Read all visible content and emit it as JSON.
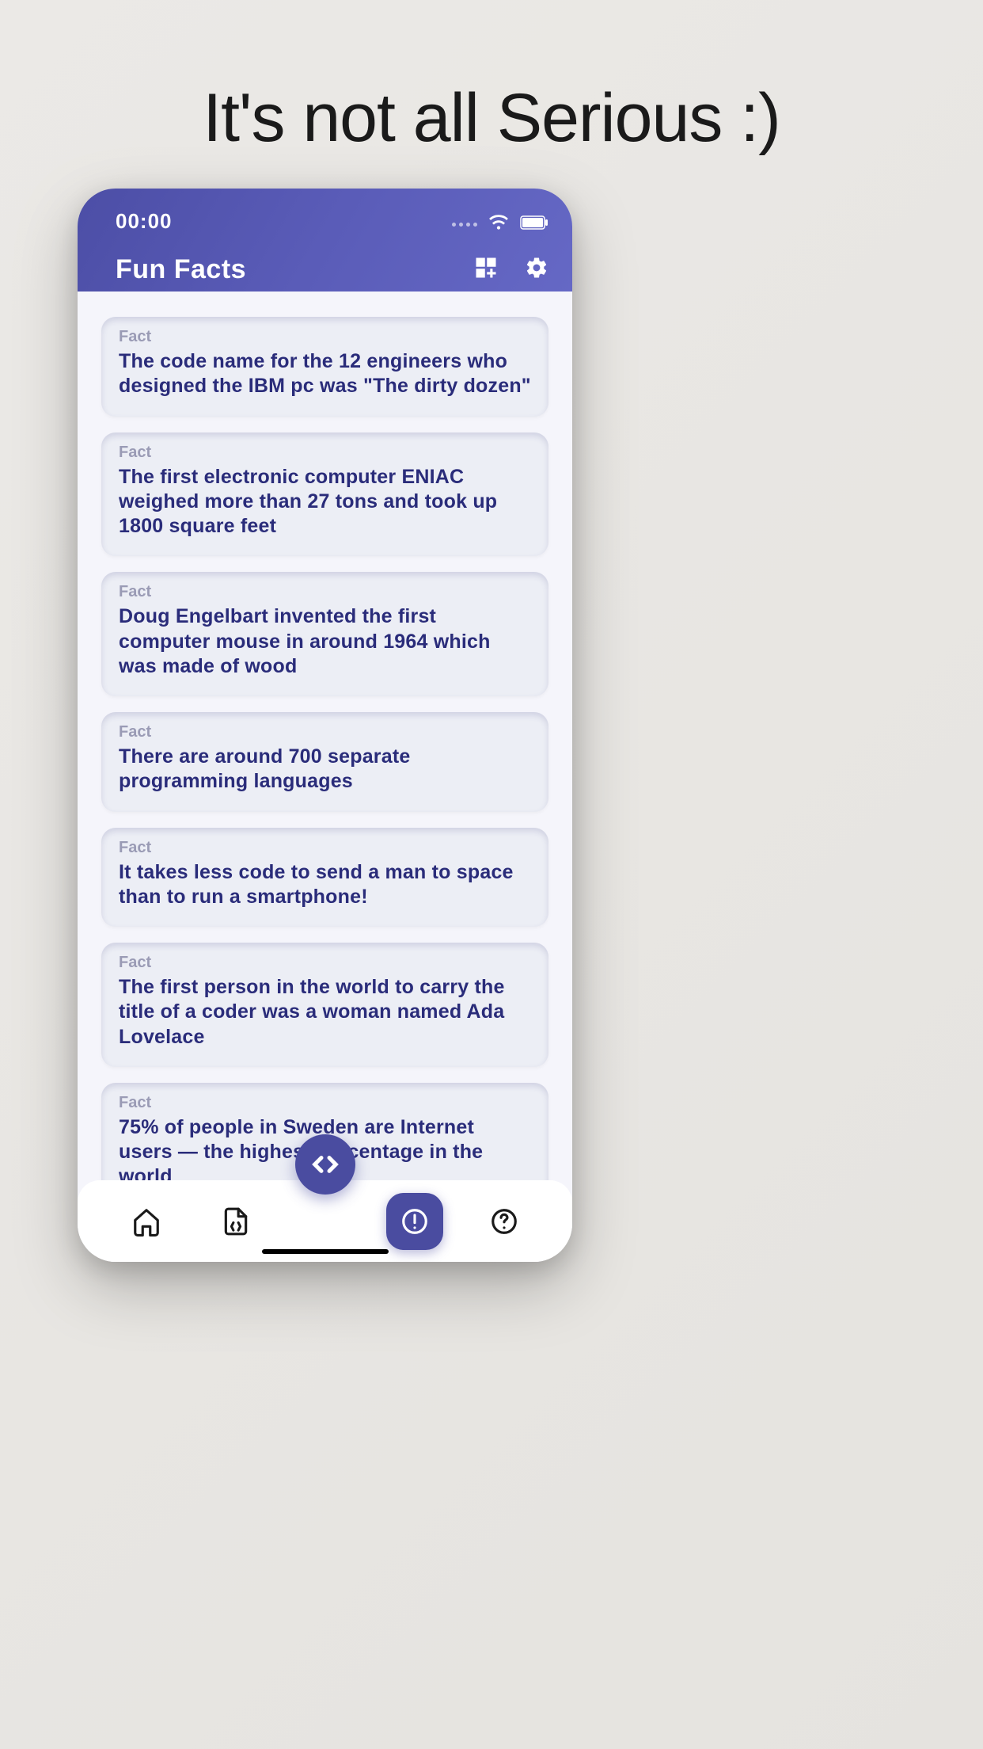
{
  "marketing": {
    "title": "It's not all Serious :)"
  },
  "status": {
    "time": "00:00"
  },
  "header": {
    "title": "Fun Facts"
  },
  "facts": {
    "label": "Fact",
    "items": [
      {
        "text": "The code name for the 12 engineers who designed the IBM pc was \"The dirty dozen\""
      },
      {
        "text": "The first electronic computer ENIAC weighed more than 27 tons and took up 1800 square feet"
      },
      {
        "text": "Doug Engelbart invented the first computer mouse in around 1964 which was made of wood"
      },
      {
        "text": "There are around 700 separate programming languages"
      },
      {
        "text": "It takes less code to send a man to space than to run a smartphone!"
      },
      {
        "text": "The first person in the world to carry the title of a coder was a woman named Ada Lovelace"
      },
      {
        "text": "75% of people in Sweden are Internet users — the highest percentage in the world"
      }
    ]
  }
}
